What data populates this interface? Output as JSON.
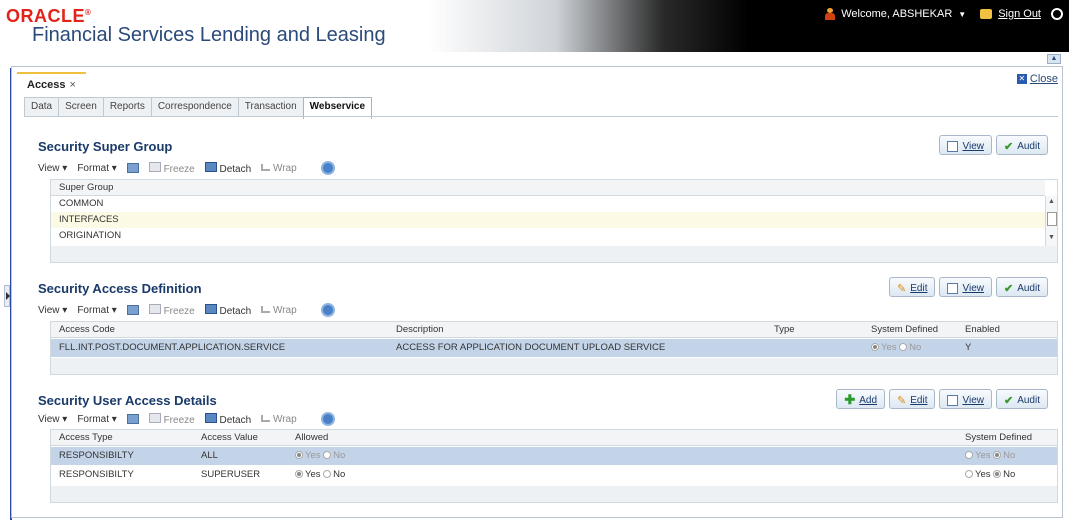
{
  "header": {
    "brand": "ORACLE",
    "brand_mark": "®",
    "product": "Financial Services Lending and Leasing",
    "welcome": "Welcome, ABSHEKAR",
    "signout": "Sign Out"
  },
  "panel": {
    "doc_tab": "Access",
    "doc_tab_close": "×",
    "close": "Close",
    "tabs": [
      "Data",
      "Screen",
      "Reports",
      "Correspondence",
      "Transaction",
      "Webservice"
    ],
    "active_tab": "Webservice"
  },
  "toolbar": {
    "view": "View",
    "format": "Format",
    "freeze": "Freeze",
    "detach": "Detach",
    "wrap": "Wrap"
  },
  "buttons": {
    "view": "View",
    "audit": "Audit",
    "edit": "Edit",
    "add": "Add"
  },
  "super_group": {
    "title": "Security Super Group",
    "header": "Super Group",
    "rows": [
      "COMMON",
      "INTERFACES",
      "ORIGINATION"
    ]
  },
  "access_def": {
    "title": "Security Access Definition",
    "headers": [
      "Access Code",
      "Description",
      "Type",
      "System Defined",
      "Enabled"
    ],
    "row": {
      "code": "FLL.INT.POST.DOCUMENT.APPLICATION.SERVICE",
      "description": "ACCESS FOR APPLICATION DOCUMENT UPLOAD SERVICE",
      "type": "",
      "yes": "Yes",
      "no": "No",
      "enabled": "Y"
    }
  },
  "user_access": {
    "title": "Security User Access Details",
    "headers": [
      "Access Type",
      "Access Value",
      "Allowed",
      "System Defined"
    ],
    "rows": [
      {
        "type": "RESPONSIBILTY",
        "value": "ALL",
        "yes": "Yes",
        "no": "No",
        "sys_yes": "Yes",
        "sys_no": "No"
      },
      {
        "type": "RESPONSIBILTY",
        "value": "SUPERUSER",
        "yes": "Yes",
        "no": "No",
        "sys_yes": "Yes",
        "sys_no": "No"
      }
    ]
  }
}
